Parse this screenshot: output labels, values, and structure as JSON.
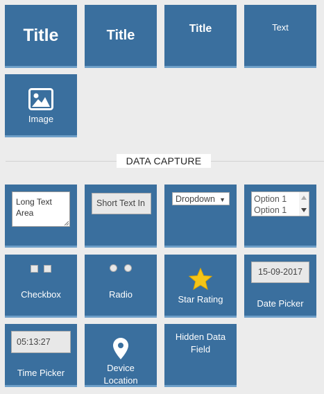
{
  "tiles_row1": {
    "title_xl": "Title",
    "title_l": "Title",
    "title_m": "Title",
    "text": "Text"
  },
  "image_tile": {
    "label": "Image"
  },
  "section": {
    "title": "DATA CAPTURE"
  },
  "long_text": {
    "label": "Long Text Area"
  },
  "short_text": {
    "label": "Short Text In"
  },
  "dropdown": {
    "label": "Dropdown",
    "arrow": "▼"
  },
  "listbox": {
    "options": [
      "Option 1",
      "Option 1"
    ]
  },
  "checkbox": {
    "label": "Checkbox"
  },
  "radio": {
    "label": "Radio"
  },
  "star_rating": {
    "label": "Star Rating"
  },
  "date_picker": {
    "value": "15-09-2017",
    "label": "Date Picker"
  },
  "time_picker": {
    "value": "05:13:27",
    "label": "Time Picker"
  },
  "device_location": {
    "line1": "Device",
    "line2": "Location"
  },
  "hidden_field": {
    "line1": "Hidden Data",
    "line2": "Field"
  },
  "colors": {
    "tile": "#3a6f9e",
    "tile_border": "#6e9fc8",
    "star": "#f5c518",
    "background": "#ececec"
  }
}
